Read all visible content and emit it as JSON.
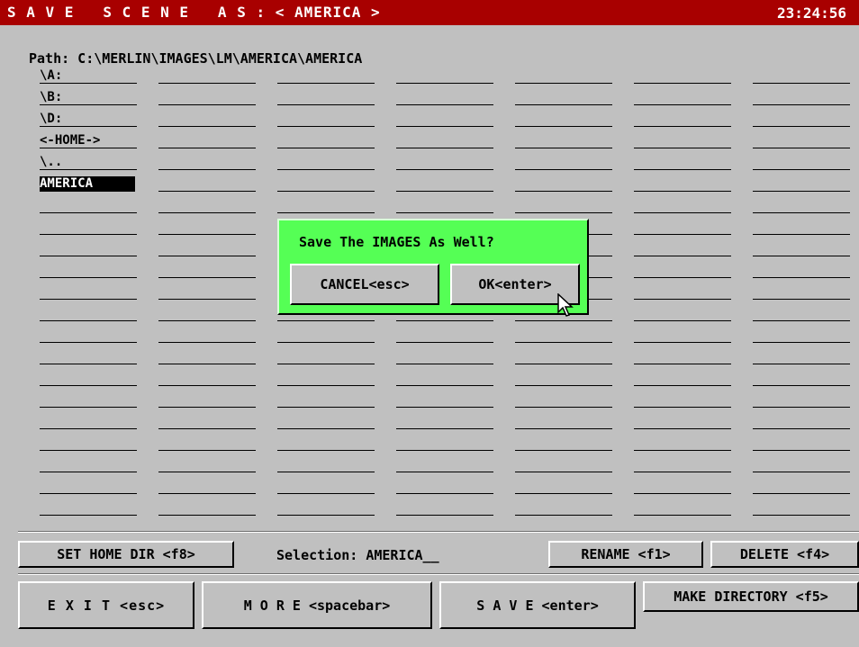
{
  "title_bar": {
    "title": "S A V E   S C E N E   A S : < AMERICA >",
    "clock": "23:24:56"
  },
  "path": "Path: C:\\MERLIN\\IMAGES\\LM\\AMERICA\\AMERICA",
  "file_list": {
    "entries": [
      "\\A:",
      "\\B:",
      "\\D:",
      "<-HOME->",
      "\\..",
      "AMERICA"
    ],
    "selected_entry": "AMERICA"
  },
  "dialog": {
    "prompt": "Save The IMAGES As Well?",
    "cancel_label": "CANCEL<esc>",
    "ok_label": "OK<enter>"
  },
  "toolbar": {
    "set_home_label": "SET HOME DIR <f8>",
    "selection_text": "Selection: AMERICA__",
    "rename_label": "RENAME <f1>",
    "delete_label": "DELETE <f4>",
    "exit_label": "E X I T <esc>",
    "more_label": "M O R E <spacebar>",
    "save_label": "S A V E <enter>",
    "make_dir_label": "MAKE DIRECTORY <f5>"
  },
  "colors": {
    "title_bar": "#a80000",
    "dialog": "#55ff55",
    "background": "#c0c0c0"
  },
  "icons": {
    "cursor": "mouse-pointer-icon"
  }
}
